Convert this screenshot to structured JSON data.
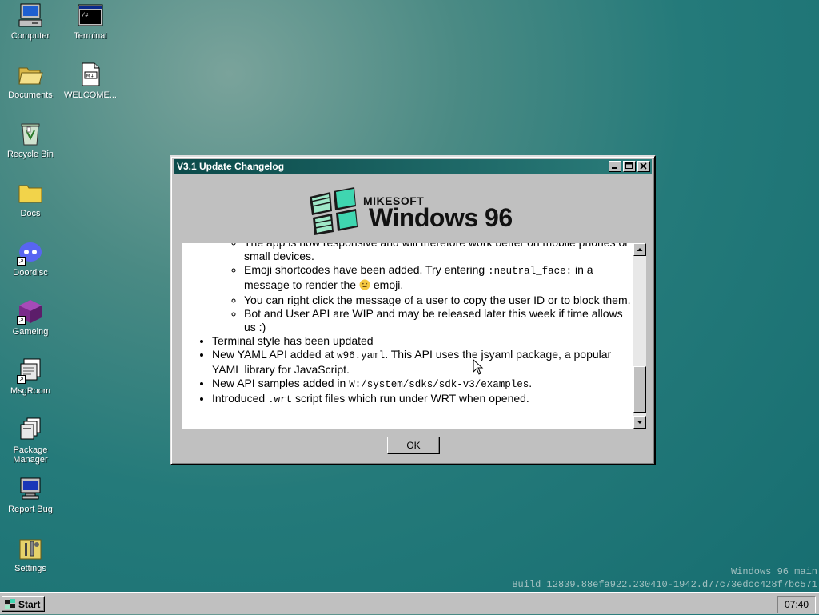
{
  "desktop": {
    "icons": [
      {
        "label": "Computer",
        "icon": "computer-icon"
      },
      {
        "label": "Terminal",
        "icon": "terminal-icon"
      },
      {
        "label": "Documents",
        "icon": "open-folder-icon"
      },
      {
        "label": "WELCOME...",
        "icon": "markdown-file-icon"
      },
      {
        "label": "Recycle Bin",
        "icon": "recycle-bin-icon"
      },
      {
        "label": "Docs",
        "icon": "folder-icon"
      },
      {
        "label": "Doordisc",
        "icon": "discord-icon"
      },
      {
        "label": "Gameing",
        "icon": "cube-icon"
      },
      {
        "label": "MsgRoom",
        "icon": "msgroom-icon"
      },
      {
        "label": "Package Manager",
        "icon": "package-manager-icon"
      },
      {
        "label": "Report Bug",
        "icon": "monitor-bug-icon"
      },
      {
        "label": "Settings",
        "icon": "settings-tools-icon"
      }
    ]
  },
  "window": {
    "title": "V3.1 Update Changelog",
    "logo_top": "MIKESOFT",
    "logo_main": "Windows 96",
    "changelog": {
      "sub1": "The app is now responsive and will therefore work better on mobile phones or small devices.",
      "sub2_a": "Emoji shortcodes have been added. Try entering ",
      "sub2_code": ":neutral_face:",
      "sub2_b": " in a message to render the ",
      "sub2_c": " emoji.",
      "sub3": "You can right click the message of a user to copy the user ID or to block them.",
      "sub4": "Bot and User API are WIP and may be released later this week if time allows us :)",
      "item1": "Terminal style has been updated",
      "item2_a": "New YAML API added at ",
      "item2_code": "w96.yaml",
      "item2_b": ". This API uses the jsyaml package, a popular YAML library for JavaScript.",
      "item3_a": "New API samples added in ",
      "item3_code": "W:/system/sdks/sdk-v3/examples",
      "item3_b": ".",
      "item4_a": "Introduced ",
      "item4_code": ".wrt",
      "item4_b": " script files which run under WRT when opened."
    },
    "ok_label": "OK"
  },
  "watermark": {
    "line1": "Windows 96 main",
    "line2": "Build 12839.88efa922.230410-1942.d77c73edcc428f7bc571"
  },
  "taskbar": {
    "start_label": "Start",
    "clock": "07:40"
  },
  "colors": {
    "desktop": "#247a7a",
    "titlebar": "#0b4a4a",
    "window_face": "#c0c0c0"
  }
}
